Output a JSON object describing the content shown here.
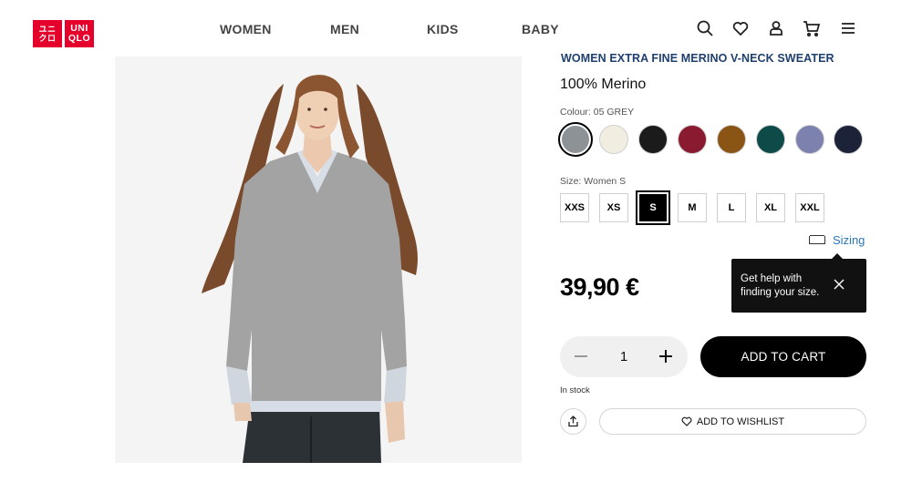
{
  "header": {
    "logo_top": "UNI",
    "logo_bottom": "QLO",
    "nav": [
      "WOMEN",
      "MEN",
      "KIDS",
      "BABY"
    ],
    "icons": [
      "search-icon",
      "heart-icon",
      "user-icon",
      "cart-icon",
      "menu-icon"
    ]
  },
  "product": {
    "title": "WOMEN EXTRA FINE MERINO V-NECK SWEATER",
    "material": "100% Merino",
    "colour_label": "Colour: 05 GREY",
    "colours": [
      {
        "name": "grey",
        "hex": "#8d9296",
        "selected": true
      },
      {
        "name": "cream",
        "hex": "#f1ede1"
      },
      {
        "name": "black",
        "hex": "#1b1b1b"
      },
      {
        "name": "wine",
        "hex": "#8a1a30"
      },
      {
        "name": "brown",
        "hex": "#8a5415"
      },
      {
        "name": "green",
        "hex": "#0d4a48"
      },
      {
        "name": "lavender",
        "hex": "#7d81ad"
      },
      {
        "name": "navy",
        "hex": "#1c2238"
      }
    ],
    "size_label": "Size: Women S",
    "sizes": [
      "XXS",
      "XS",
      "S",
      "M",
      "L",
      "XL",
      "XXL"
    ],
    "selected_size": "S",
    "sizing_link": "Sizing",
    "tooltip_text": "Get help with finding your size.",
    "price": "39,90 €",
    "quantity": "1",
    "add_to_cart": "ADD TO CART",
    "stock": "In stock",
    "wishlist": "ADD TO WISHLIST"
  },
  "colors": {
    "brand_red": "#e4002b",
    "title_blue": "#1f3f6e",
    "link_blue": "#2b76b9"
  }
}
